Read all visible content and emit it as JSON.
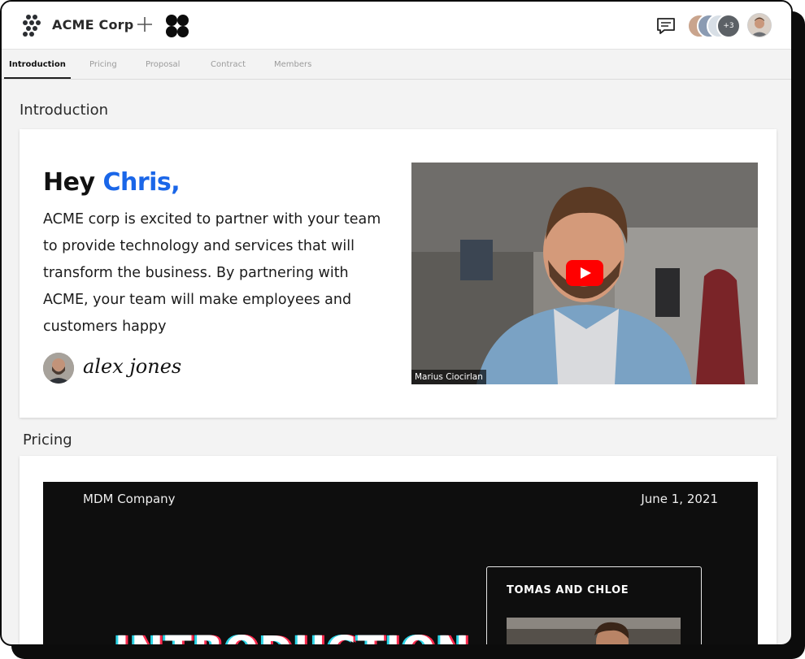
{
  "header": {
    "brand": "ACME Corp",
    "collaborators_more": "+3"
  },
  "tabs": [
    {
      "label": "Introduction",
      "active": true
    },
    {
      "label": "Pricing",
      "active": false
    },
    {
      "label": "Proposal",
      "active": false
    },
    {
      "label": "Contract",
      "active": false
    },
    {
      "label": "Members",
      "active": false
    }
  ],
  "introduction": {
    "section_title": "Introduction",
    "greeting_prefix": "Hey ",
    "greeting_name": "Chris,",
    "body": "ACME corp is excited to partner with your team to provide technology and services that will transform the business. By partnering with ACME,  your team will make employees and customers happy",
    "signature": "alex jones",
    "video_caption": "Marius Ciocirlan"
  },
  "pricing": {
    "section_title": "Pricing",
    "doc_company": "MDM Company",
    "doc_date": "June 1, 2021",
    "doc_box_title": "TOMAS AND CHLOE",
    "doc_heading": "INTRODUCTION"
  },
  "colors": {
    "accent_blue": "#1a66e8",
    "youtube_red": "#ff0000"
  }
}
